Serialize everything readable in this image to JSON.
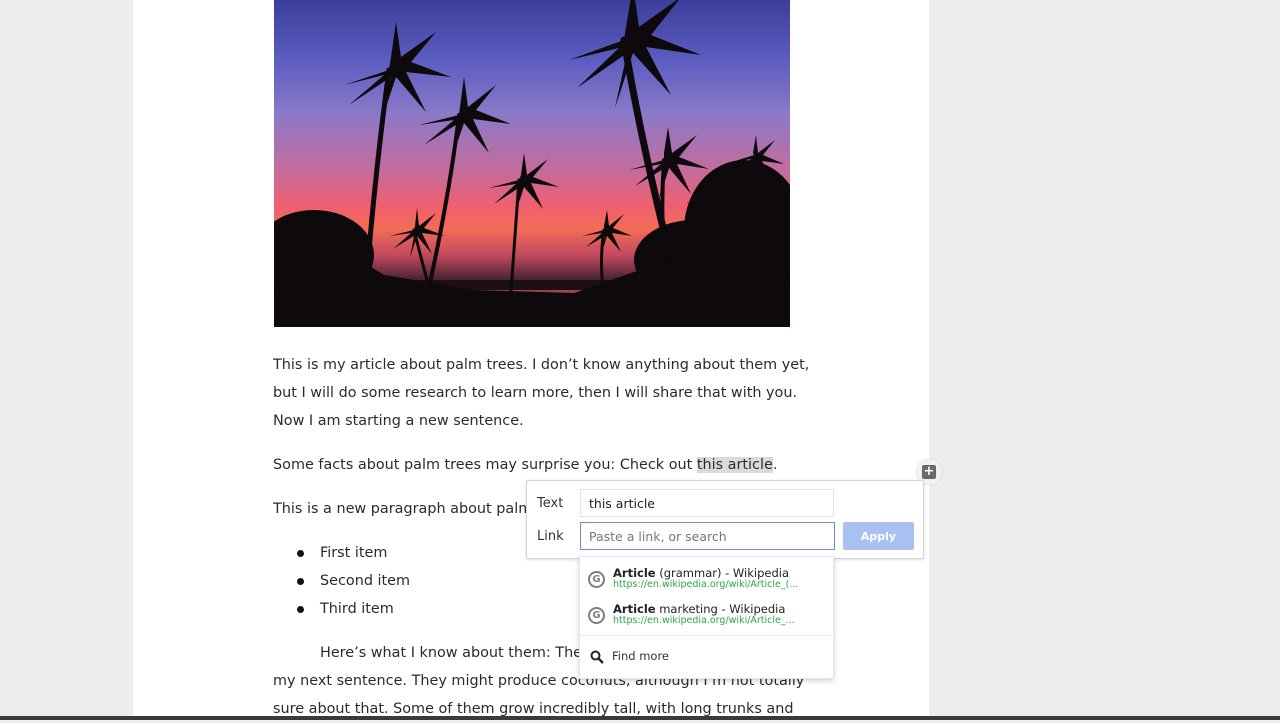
{
  "article": {
    "paragraph1": [
      "This is my article about palm trees. I don’t know anything about them yet,",
      "but I will do some research to learn more, then I will share that with you.",
      "Now I am starting a new sentence."
    ],
    "paragraph2_before": "Some facts about palm trees may surprise you: Check out ",
    "paragraph2_link": "this article",
    "paragraph2_after": ".",
    "paragraph3": "This is a new paragraph about palm t",
    "list_items": [
      "First item",
      "Second item",
      "Third item"
    ],
    "paragraph4_line1": "Here’s what I know about them: They g",
    "paragraph4_line2": "my next sentence. They might produce coconuts, although I’m not totally",
    "paragraph4_line3": "sure about that. Some of them grow incredibly tall, with long trunks and"
  },
  "link_popup": {
    "text_label": "Text",
    "text_value": "this article",
    "link_label": "Link",
    "link_placeholder": "Paste a link, or search",
    "link_value": "",
    "apply_label": "Apply"
  },
  "suggestions": [
    {
      "title_bold": "Article",
      "title_rest": " (grammar) - Wikipedia",
      "url": "https://en.wikipedia.org/wiki/Article_(...",
      "icon": "google-icon"
    },
    {
      "title_bold": "Article",
      "title_rest": " marketing - Wikipedia",
      "url": "https://en.wikipedia.org/wiki/Article_...",
      "icon": "google-icon"
    }
  ],
  "find_more_label": "Find more",
  "colors": {
    "apply_button": "#a8c0f2",
    "url_green": "#2da34e",
    "link_input_border": "#6a8ad6"
  }
}
